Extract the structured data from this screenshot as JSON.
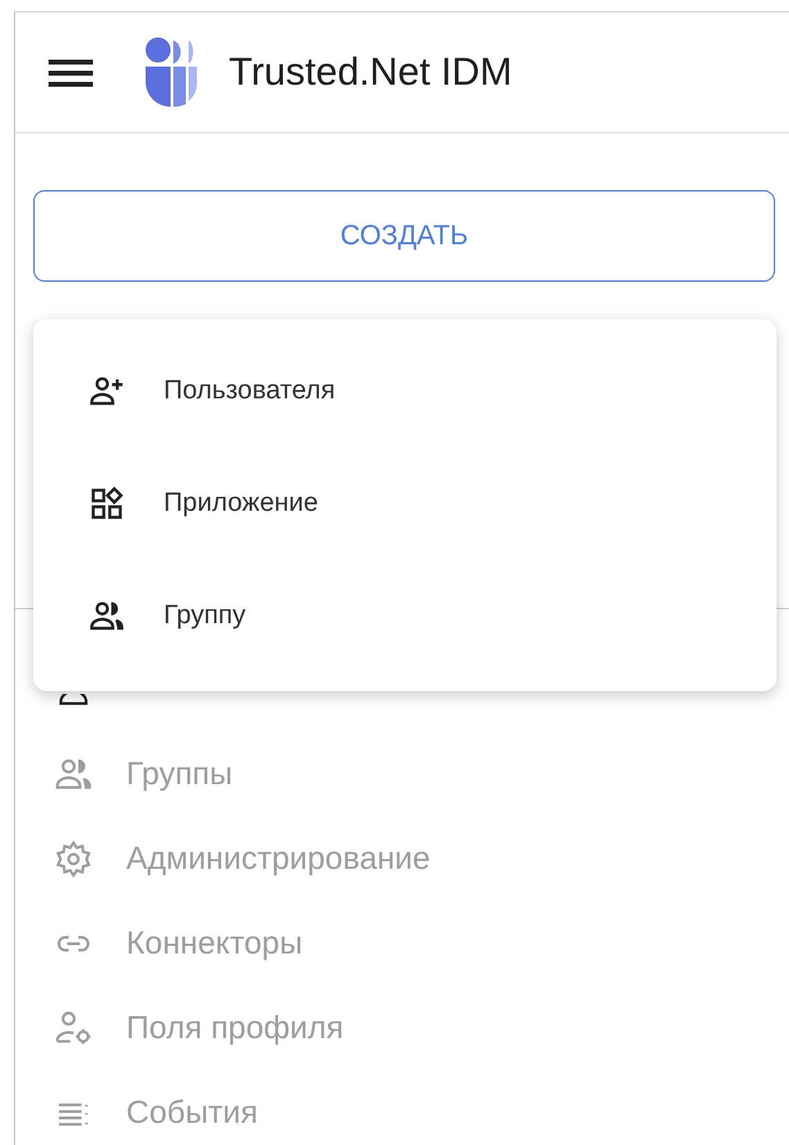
{
  "header": {
    "title": "Trusted.Net IDM"
  },
  "create_button": {
    "label": "СОЗДАТЬ"
  },
  "create_menu": {
    "items": [
      {
        "label": "Пользователя",
        "kind": "user-add"
      },
      {
        "label": "Приложение",
        "kind": "apps"
      },
      {
        "label": "Группу",
        "kind": "group"
      }
    ]
  },
  "sidebar": {
    "items": [
      {
        "kind": "user",
        "selected": true
      },
      {
        "label": "Группы",
        "kind": "group",
        "selected": false
      },
      {
        "label": "Администрирование",
        "kind": "gear",
        "selected": false
      },
      {
        "label": "Коннекторы",
        "kind": "link",
        "selected": false
      },
      {
        "label": "Поля профиля",
        "kind": "user-gear",
        "selected": false
      },
      {
        "label": "События",
        "kind": "list",
        "selected": false
      }
    ]
  }
}
